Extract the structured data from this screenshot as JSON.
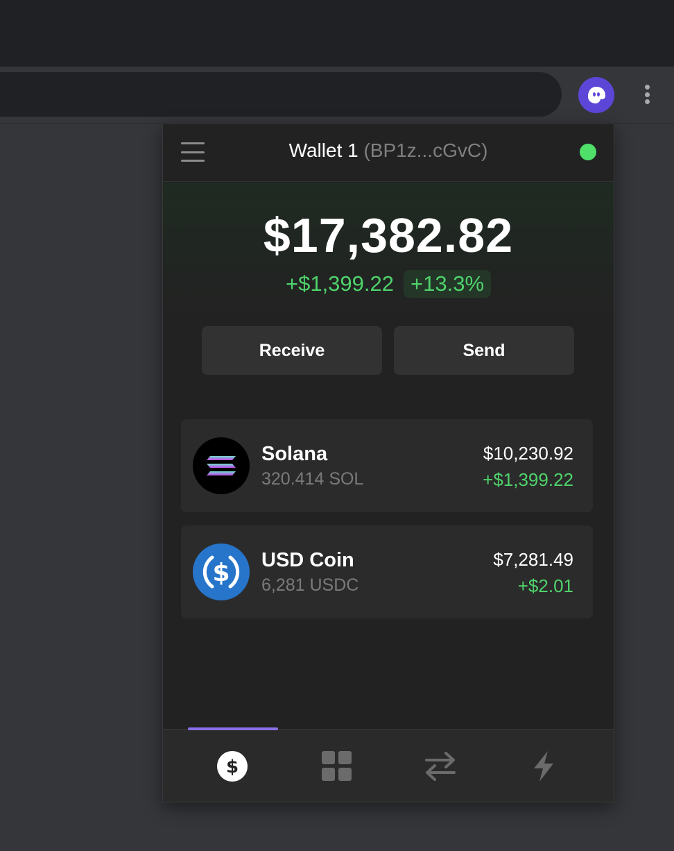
{
  "browser": {
    "extension_icon": "phantom-ghost-icon",
    "menu_icon": "kebab-menu-icon"
  },
  "header": {
    "menu_icon": "hamburger-menu-icon",
    "wallet_name": "Wallet 1",
    "wallet_address": "(BP1z...cGvC)",
    "status": "connected",
    "status_color": "#4fe06a"
  },
  "balance": {
    "total": "$17,382.82",
    "change_amount": "+$1,399.22",
    "change_percent": "+13.3%"
  },
  "actions": {
    "receive_label": "Receive",
    "send_label": "Send"
  },
  "tokens": [
    {
      "name": "Solana",
      "quantity": "320.414 SOL",
      "usd_value": "$10,230.92",
      "change": "+$1,399.22",
      "icon": "solana-icon"
    },
    {
      "name": "USD Coin",
      "quantity": "6,281 USDC",
      "usd_value": "$7,281.49",
      "change": "+$2.01",
      "icon": "usdc-icon"
    }
  ],
  "nav": {
    "items": [
      {
        "icon": "dollar-icon",
        "active": true
      },
      {
        "icon": "grid-icon",
        "active": false
      },
      {
        "icon": "swap-arrows-icon",
        "active": false
      },
      {
        "icon": "lightning-icon",
        "active": false
      }
    ],
    "accent": "#8a6fe8"
  },
  "colors": {
    "positive": "#4fd36b",
    "background": "#222222",
    "card": "#2b2b2b"
  }
}
